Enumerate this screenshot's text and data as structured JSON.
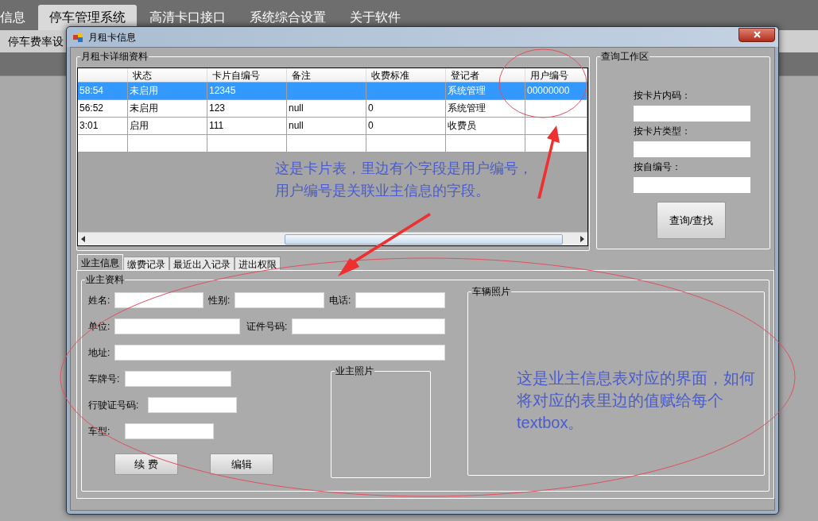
{
  "app_tabs": [
    {
      "label": "信息",
      "selected": false
    },
    {
      "label": "停车管理系统",
      "selected": true
    },
    {
      "label": "高清卡口接口",
      "selected": false
    },
    {
      "label": "系统综合设置",
      "selected": false
    },
    {
      "label": "关于软件",
      "selected": false
    }
  ],
  "toolbar": {
    "item": "停车费率设"
  },
  "dialog": {
    "title": "月租卡信息",
    "card_group": {
      "title": "月租卡详细资料",
      "columns": [
        "",
        "状态",
        "卡片自编号",
        "备注",
        "收费标准",
        "登记者",
        "用户编号"
      ],
      "rows": [
        {
          "selected": true,
          "cells": [
            "58:54",
            "未启用",
            "12345",
            "",
            "",
            "系统管理",
            "00000000"
          ]
        },
        {
          "selected": false,
          "cells": [
            "56:52",
            "未启用",
            "123",
            "null",
            "0",
            "系统管理",
            ""
          ]
        },
        {
          "selected": false,
          "cells": [
            "3:01",
            "启用",
            "111",
            "null",
            "0",
            "收费员",
            ""
          ]
        }
      ]
    },
    "query_group": {
      "title": "查询工作区",
      "fields": [
        {
          "label": "按卡片内码："
        },
        {
          "label": "按卡片类型："
        },
        {
          "label": "按自编号："
        }
      ],
      "button": "查询/查找"
    },
    "tabs": [
      {
        "label": "业主信息",
        "selected": true
      },
      {
        "label": "缴费记录",
        "selected": false
      },
      {
        "label": "最近出入记录",
        "selected": false
      },
      {
        "label": "进出权限",
        "selected": false
      }
    ],
    "owner_group": {
      "title": "业主资料",
      "rows": [
        [
          {
            "label": "姓名:"
          },
          {
            "label": "性别:"
          },
          {
            "label": "电话:"
          }
        ],
        [
          {
            "label": "单位:"
          },
          {
            "label": "证件号码:"
          }
        ],
        [
          {
            "label": "地址:"
          }
        ],
        [
          {
            "label": "车牌号:"
          }
        ],
        [
          {
            "label": "行驶证号码:"
          }
        ],
        [
          {
            "label": "车型:"
          }
        ]
      ],
      "buttons": [
        "续 费",
        "编辑"
      ],
      "owner_photo": "业主照片",
      "vehicle_photo": "车辆照片"
    }
  },
  "annotations": [
    {
      "lines": [
        "这是卡片表，里边有个字段是用户编号，",
        "用户编号是关联业主信息的字段。"
      ]
    },
    {
      "lines": [
        "这是业主信息表对应的界面，如何",
        "将对应的表里边的值赋给每个",
        "textbox。"
      ]
    }
  ]
}
